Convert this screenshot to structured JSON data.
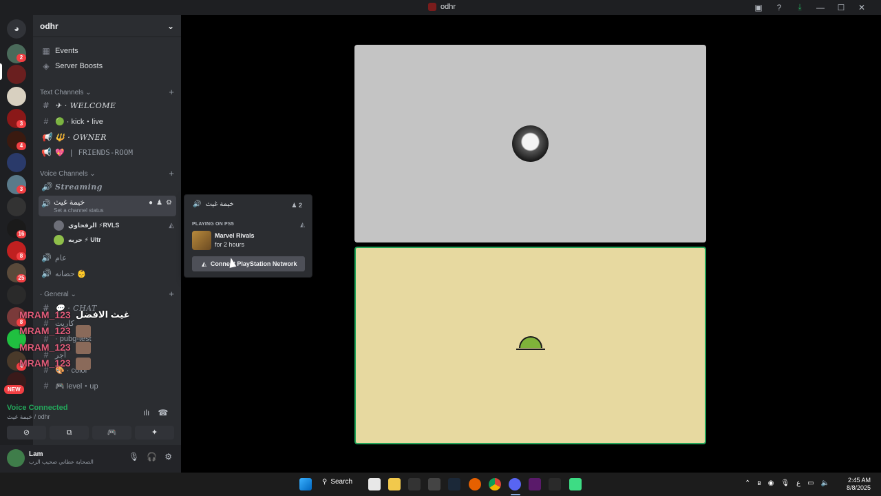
{
  "window": {
    "title": "odhr"
  },
  "titlebar_icons": [
    "screen-share-icon",
    "help-icon",
    "download-icon",
    "minimize-icon",
    "maximize-icon",
    "close-icon"
  ],
  "rail": {
    "badges": [
      "2",
      "3",
      "4",
      "3",
      "16",
      "8",
      "25",
      "8",
      "4"
    ],
    "new_label": "NEW"
  },
  "server": {
    "name": "odhr"
  },
  "top_items": [
    {
      "label": "Events",
      "icon": "calendar-icon"
    },
    {
      "label": "Server Boosts",
      "icon": "boost-icon"
    }
  ],
  "text_category": "Text Channels",
  "text_channels": [
    {
      "label": "✈ · WELCOME",
      "icon": "hash-icon"
    },
    {
      "label": "🟢 · kick・live",
      "icon": "hash-icon"
    },
    {
      "label": "🔱 · OWNER",
      "icon": "announcement-icon"
    },
    {
      "label": "💖 | FRIENDS-ROOM",
      "icon": "announcement-icon"
    }
  ],
  "voice_category": "Voice Channels",
  "voice_channels": {
    "streaming": "Streaming",
    "active": {
      "name": "خيمة غيث",
      "status": "Set a channel status"
    },
    "users": [
      {
        "name": "الرفحاوي ⚡RVLS"
      },
      {
        "name": "حربه ⚡ Ultr"
      }
    ],
    "others": [
      "عام",
      "حضانه 👶"
    ]
  },
  "general_category": "· General",
  "general_channels": [
    {
      "label": "💬 · CHAT"
    },
    {
      "label": "كاريت"
    },
    {
      "label": "· pubg-test"
    },
    {
      "label": "أجر"
    },
    {
      "label": "🎨 · color"
    },
    {
      "label": "🎮 level・up"
    }
  ],
  "overlay": {
    "names": [
      "MRAM_123",
      "MRAM_123",
      "MRAM_123",
      "MRAM_123"
    ],
    "top_name": "غيث الافضل"
  },
  "voice_panel": {
    "status": "Voice Connected",
    "location": "خيمة غيث / odhr"
  },
  "user": {
    "name": "Lam",
    "status": "الصحابة عطاني صحيب الرب"
  },
  "popup": {
    "channel": "خيمة غيث",
    "count": "2",
    "section_label": "PLAYING ON PS5",
    "game": "Marvel Rivals",
    "time": "for 2 hours",
    "connect_label": "Connect PlayStation Network"
  },
  "taskbar": {
    "search_label": "Search",
    "time": "2:45 AM",
    "date": "8/8/2025",
    "lang": "ع"
  },
  "colors": {
    "accent_green": "#23a55a",
    "tile_top": "#c4c4c4",
    "tile_bottom": "#e7d9a0",
    "danger": "#f23f43"
  }
}
